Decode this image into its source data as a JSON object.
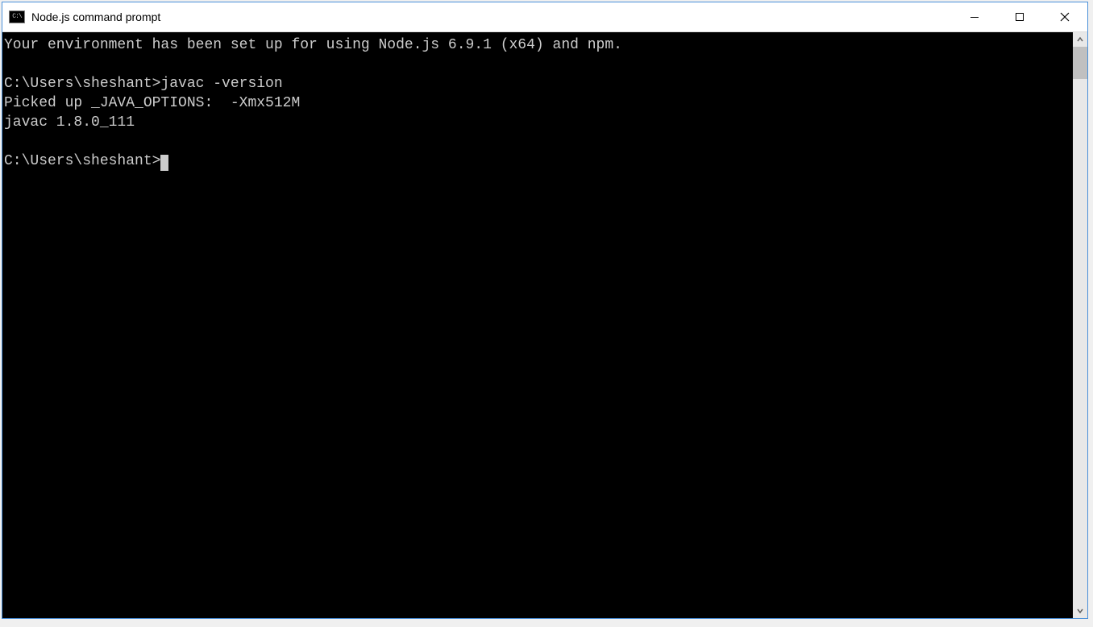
{
  "window": {
    "title": "Node.js command prompt"
  },
  "terminal": {
    "lines": [
      "Your environment has been set up for using Node.js 6.9.1 (x64) and npm.",
      "",
      "C:\\Users\\sheshant>javac -version",
      "Picked up _JAVA_OPTIONS:  -Xmx512M",
      "javac 1.8.0_111",
      "",
      "C:\\Users\\sheshant>"
    ]
  }
}
